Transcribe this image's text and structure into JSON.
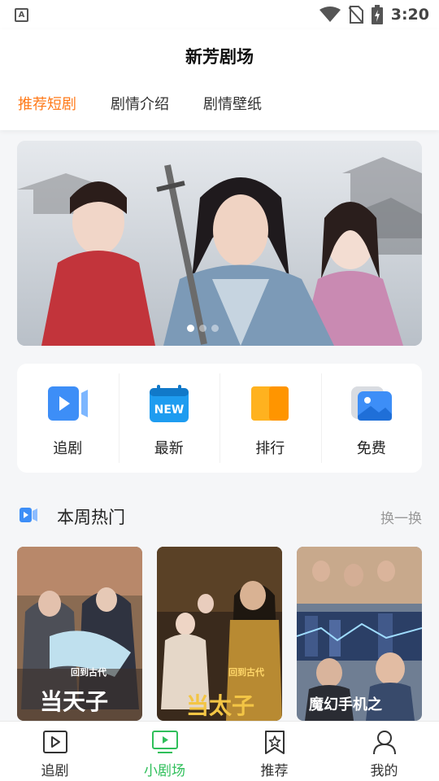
{
  "status_bar": {
    "time": "3:20",
    "notification_letter": "A"
  },
  "header": {
    "title": "新芳剧场"
  },
  "tabs": [
    {
      "label": "推荐短剧",
      "active": true
    },
    {
      "label": "剧情介绍",
      "active": false
    },
    {
      "label": "剧情壁纸",
      "active": false
    }
  ],
  "banner": {
    "page_count": 3,
    "active_index": 0
  },
  "quick_menu": [
    {
      "label": "追剧",
      "icon": "video-icon"
    },
    {
      "label": "最新",
      "icon": "new-calendar-icon",
      "icon_text": "NEW"
    },
    {
      "label": "排行",
      "icon": "ranking-icon"
    },
    {
      "label": "免费",
      "icon": "free-image-icon"
    }
  ],
  "section": {
    "title": "本周热门",
    "refresh_label": "换一换"
  },
  "posters": [
    {
      "caption": "回到古代",
      "title_art": "当天子"
    },
    {
      "caption": "回到古代",
      "title_art": "当太子"
    },
    {
      "caption": "",
      "title_art": "魔幻手机之"
    }
  ],
  "bottom_nav": [
    {
      "label": "追剧",
      "icon": "play-square-icon",
      "active": false
    },
    {
      "label": "小剧场",
      "icon": "tv-icon",
      "active": true
    },
    {
      "label": "推荐",
      "icon": "star-bookmark-icon",
      "active": false
    },
    {
      "label": "我的",
      "icon": "user-icon",
      "active": false
    }
  ],
  "colors": {
    "accent_orange": "#ff7a1a",
    "accent_green": "#2fbf5a",
    "accent_blue": "#3d8ef7"
  }
}
